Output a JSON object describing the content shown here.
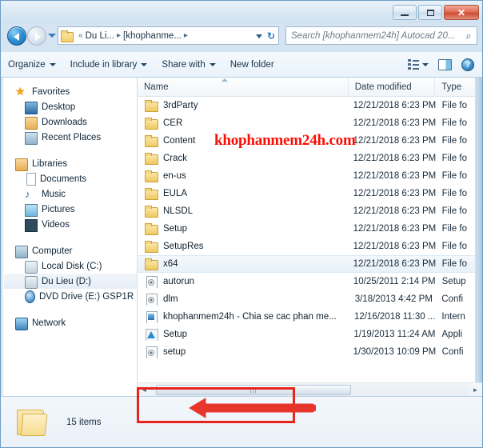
{
  "window": {
    "controls": {
      "minimize": "minimize",
      "maximize": "maximize",
      "close": "✕"
    }
  },
  "address": {
    "crumb_chevrons": "«",
    "crumb1": "Du Li...",
    "sep": "▸",
    "crumb2": "[khophanme...",
    "sep2": "▸",
    "refresh": "↻"
  },
  "search": {
    "placeholder": "Search [khophanmem24h] Autocad 20...",
    "icon": "⌕"
  },
  "toolbar": {
    "organize": "Organize",
    "include_in_library": "Include in library",
    "share_with": "Share with",
    "new_folder": "New folder",
    "help": "?"
  },
  "sidebar": {
    "groups": [
      {
        "header": "Favorites",
        "items": [
          "Desktop",
          "Downloads",
          "Recent Places"
        ]
      },
      {
        "header": "Libraries",
        "items": [
          "Documents",
          "Music",
          "Pictures",
          "Videos"
        ]
      },
      {
        "header": "Computer",
        "items": [
          "Local Disk (C:)",
          "Du Lieu (D:)",
          "DVD Drive (E:) GSP1R"
        ]
      },
      {
        "header": "Network",
        "items": []
      }
    ],
    "selected": "Du Lieu (D:)"
  },
  "columns": {
    "name": "Name",
    "date_modified": "Date modified",
    "type": "Type"
  },
  "files": [
    {
      "name": "3rdParty",
      "date": "12/21/2018 6:23 PM",
      "type": "File fo",
      "icon": "folder",
      "selected": false
    },
    {
      "name": "CER",
      "date": "12/21/2018 6:23 PM",
      "type": "File fo",
      "icon": "folder",
      "selected": false
    },
    {
      "name": "Content",
      "date": "12/21/2018 6:23 PM",
      "type": "File fo",
      "icon": "folder",
      "selected": false
    },
    {
      "name": "Crack",
      "date": "12/21/2018 6:23 PM",
      "type": "File fo",
      "icon": "folder",
      "selected": false
    },
    {
      "name": "en-us",
      "date": "12/21/2018 6:23 PM",
      "type": "File fo",
      "icon": "folder",
      "selected": false
    },
    {
      "name": "EULA",
      "date": "12/21/2018 6:23 PM",
      "type": "File fo",
      "icon": "folder",
      "selected": false
    },
    {
      "name": "NLSDL",
      "date": "12/21/2018 6:23 PM",
      "type": "File fo",
      "icon": "folder",
      "selected": false
    },
    {
      "name": "Setup",
      "date": "12/21/2018 6:23 PM",
      "type": "File fo",
      "icon": "folder",
      "selected": false
    },
    {
      "name": "SetupRes",
      "date": "12/21/2018 6:23 PM",
      "type": "File fo",
      "icon": "folder",
      "selected": false
    },
    {
      "name": "x64",
      "date": "12/21/2018 6:23 PM",
      "type": "File fo",
      "icon": "folder",
      "selected": true
    },
    {
      "name": "autorun",
      "date": "10/25/2011 2:14 PM",
      "type": "Setup",
      "icon": "cfg",
      "selected": false
    },
    {
      "name": "dlm",
      "date": "3/18/2013 4:42 PM",
      "type": "Confi",
      "icon": "cfg",
      "selected": false
    },
    {
      "name": "khophanmem24h - Chia se cac phan me...",
      "date": "12/16/2018 11:30 ...",
      "type": "Intern",
      "icon": "html",
      "selected": false
    },
    {
      "name": "Setup",
      "date": "1/19/2013 11:24 AM",
      "type": "Appli",
      "icon": "app",
      "selected": false
    },
    {
      "name": "setup",
      "date": "1/30/2013 10:09 PM",
      "type": "Confi",
      "icon": "cfg",
      "selected": false
    }
  ],
  "status": {
    "items_count": "15 items"
  },
  "annotations": {
    "watermark": "khophanmem24h.com",
    "watermark_color": "#fb0d05",
    "highlight_color": "#e8251c",
    "arrow_color": "#e8352c"
  },
  "scrollbar": {
    "left_arrow": "◄",
    "right_arrow": "►",
    "thumb_grip": "|||"
  }
}
